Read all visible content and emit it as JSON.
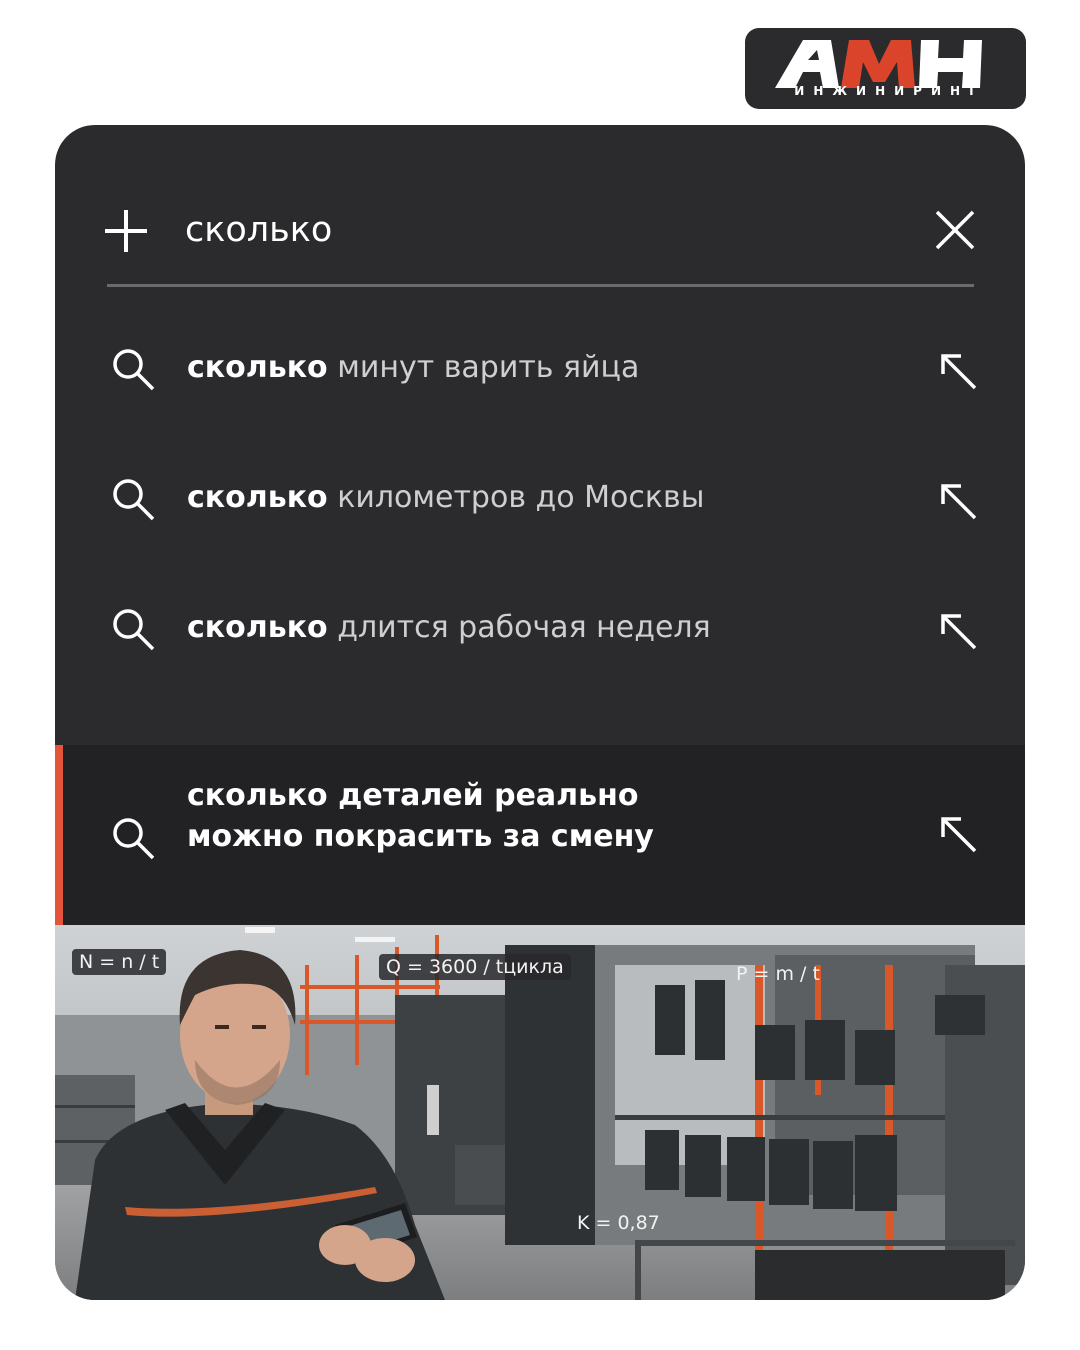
{
  "brand": {
    "logo_text": "АМН",
    "logo_subtitle": "ИНЖИНИРИНГ"
  },
  "search": {
    "query": "сколько"
  },
  "suggestions": [
    {
      "bold": "сколько",
      "rest": " минут варить яйца"
    },
    {
      "bold": "сколько",
      "rest": " километров до Москвы"
    },
    {
      "bold": "сколько",
      "rest": " длится рабочая неделя"
    }
  ],
  "highlighted": {
    "line1": "сколько деталей реально",
    "line2": "можно покрасить за смену"
  },
  "photo": {
    "formulas": [
      "N = n / t",
      "Q = 3600 / tцикла",
      "P = m / t",
      "K = 0,87"
    ]
  },
  "colors": {
    "card_bg": "#2b2b2e",
    "highlight_bg": "#222225",
    "accent": "#e2553a",
    "logo_red": "#d9442b",
    "text": "#ffffff",
    "muted_text": "#cfcfd2"
  },
  "icons": {
    "add": "plus-icon",
    "clear": "close-icon",
    "suggestion": "search-icon",
    "fill_in": "arrow-up-left-icon"
  }
}
